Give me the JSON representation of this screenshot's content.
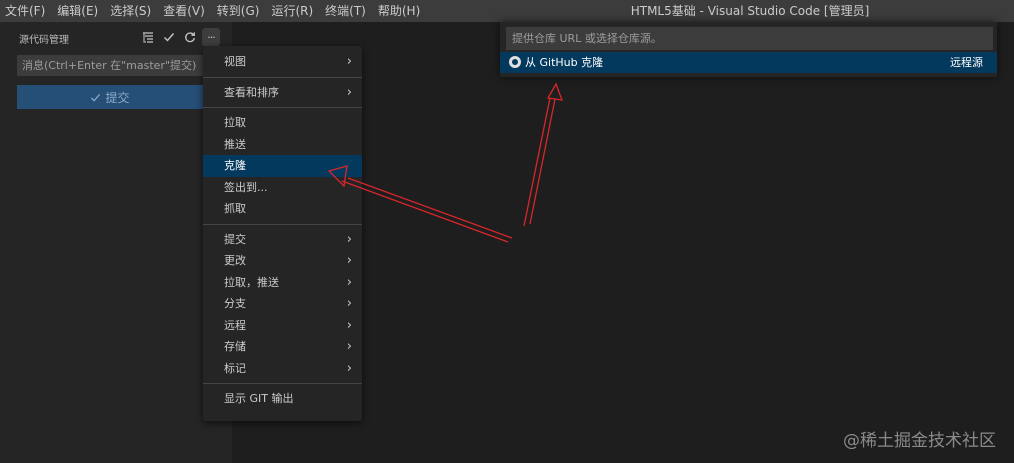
{
  "menubar": {
    "items": [
      {
        "label": "文件(F)"
      },
      {
        "label": "编辑(E)"
      },
      {
        "label": "选择(S)"
      },
      {
        "label": "查看(V)"
      },
      {
        "label": "转到(G)"
      },
      {
        "label": "运行(R)"
      },
      {
        "label": "终端(T)"
      },
      {
        "label": "帮助(H)"
      }
    ],
    "window_title": "HTML5基础 - Visual Studio Code [管理员]"
  },
  "sidebar": {
    "title": "源代码管理",
    "actions": {
      "view_as_tree_icon": "list-tree-icon",
      "commit_icon": "check-icon",
      "refresh_icon": "refresh-icon",
      "more_icon": "ellipsis-icon",
      "more_glyph": "···"
    },
    "commit_input_placeholder": "消息(Ctrl+Enter 在\"master\"提交)",
    "commit_button_label": "提交",
    "commit_button_icon": "check-icon"
  },
  "context_menu": {
    "groups": [
      [
        {
          "label": "视图",
          "submenu": true
        }
      ],
      [
        {
          "label": "查看和排序",
          "submenu": true
        }
      ],
      [
        {
          "label": "拉取",
          "submenu": false
        },
        {
          "label": "推送",
          "submenu": false
        },
        {
          "label": "克隆",
          "submenu": false,
          "active": true
        },
        {
          "label": "签出到...",
          "submenu": false
        },
        {
          "label": "抓取",
          "submenu": false
        }
      ],
      [
        {
          "label": "提交",
          "submenu": true
        },
        {
          "label": "更改",
          "submenu": true
        },
        {
          "label": "拉取，推送",
          "submenu": true
        },
        {
          "label": "分支",
          "submenu": true
        },
        {
          "label": "远程",
          "submenu": true
        },
        {
          "label": "存储",
          "submenu": true
        },
        {
          "label": "标记",
          "submenu": true
        }
      ],
      [
        {
          "label": "显示 GIT 输出",
          "submenu": false
        }
      ]
    ]
  },
  "quick_pick": {
    "placeholder": "提供仓库 URL 或选择仓库源。",
    "item_label": "从 GitHub 克隆",
    "item_description": "远程源",
    "item_icon": "github-icon"
  },
  "watermark": "@稀土掘金技术社区",
  "colors": {
    "titlebar": "#3c3c3c",
    "sidebar": "#252526",
    "editor": "#1e1e1e",
    "selection": "#04395e",
    "commit_button": "#264f78",
    "annotation_arrow": "#d9262a"
  }
}
